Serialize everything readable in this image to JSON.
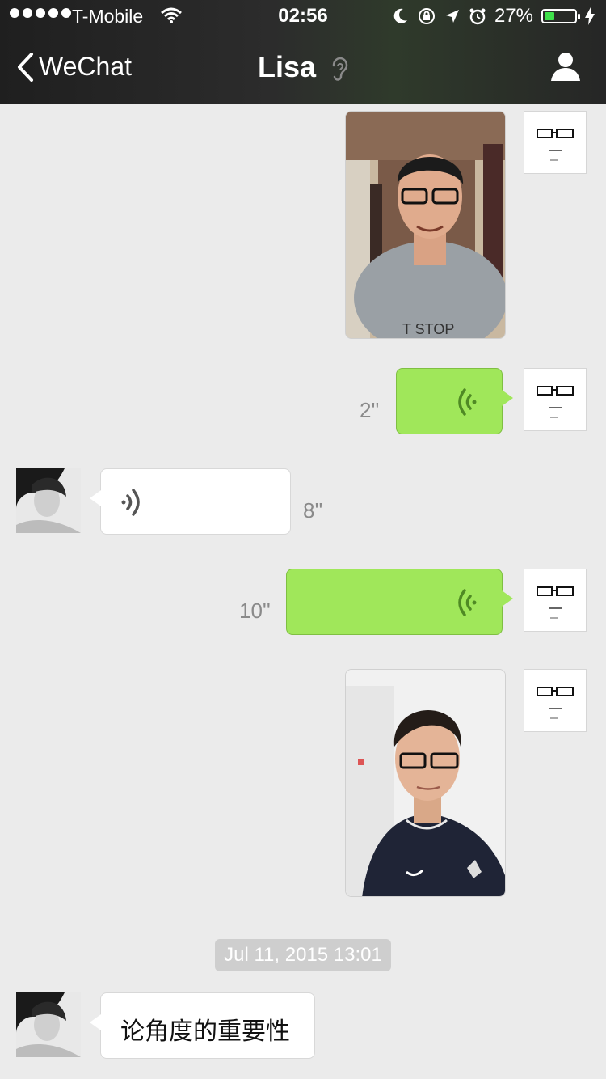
{
  "status_bar": {
    "carrier": "T-Mobile",
    "time": "02:56",
    "battery": "27%",
    "battery_color": "#3ee04a"
  },
  "nav": {
    "back_label": "WeChat",
    "title": "Lisa",
    "icons": [
      "chevron-left-icon",
      "ear-icon",
      "profile-icon"
    ]
  },
  "messages": {
    "voice_1_duration": "2''",
    "voice_2_duration": "8''",
    "voice_3_duration": "10''",
    "timestamp": "Jul 11, 2015 13:01",
    "text_1": "论角度的重要性"
  },
  "colors": {
    "sent_bubble": "#a0e75a",
    "received_bubble": "#ffffff",
    "background": "#ebebeb"
  }
}
